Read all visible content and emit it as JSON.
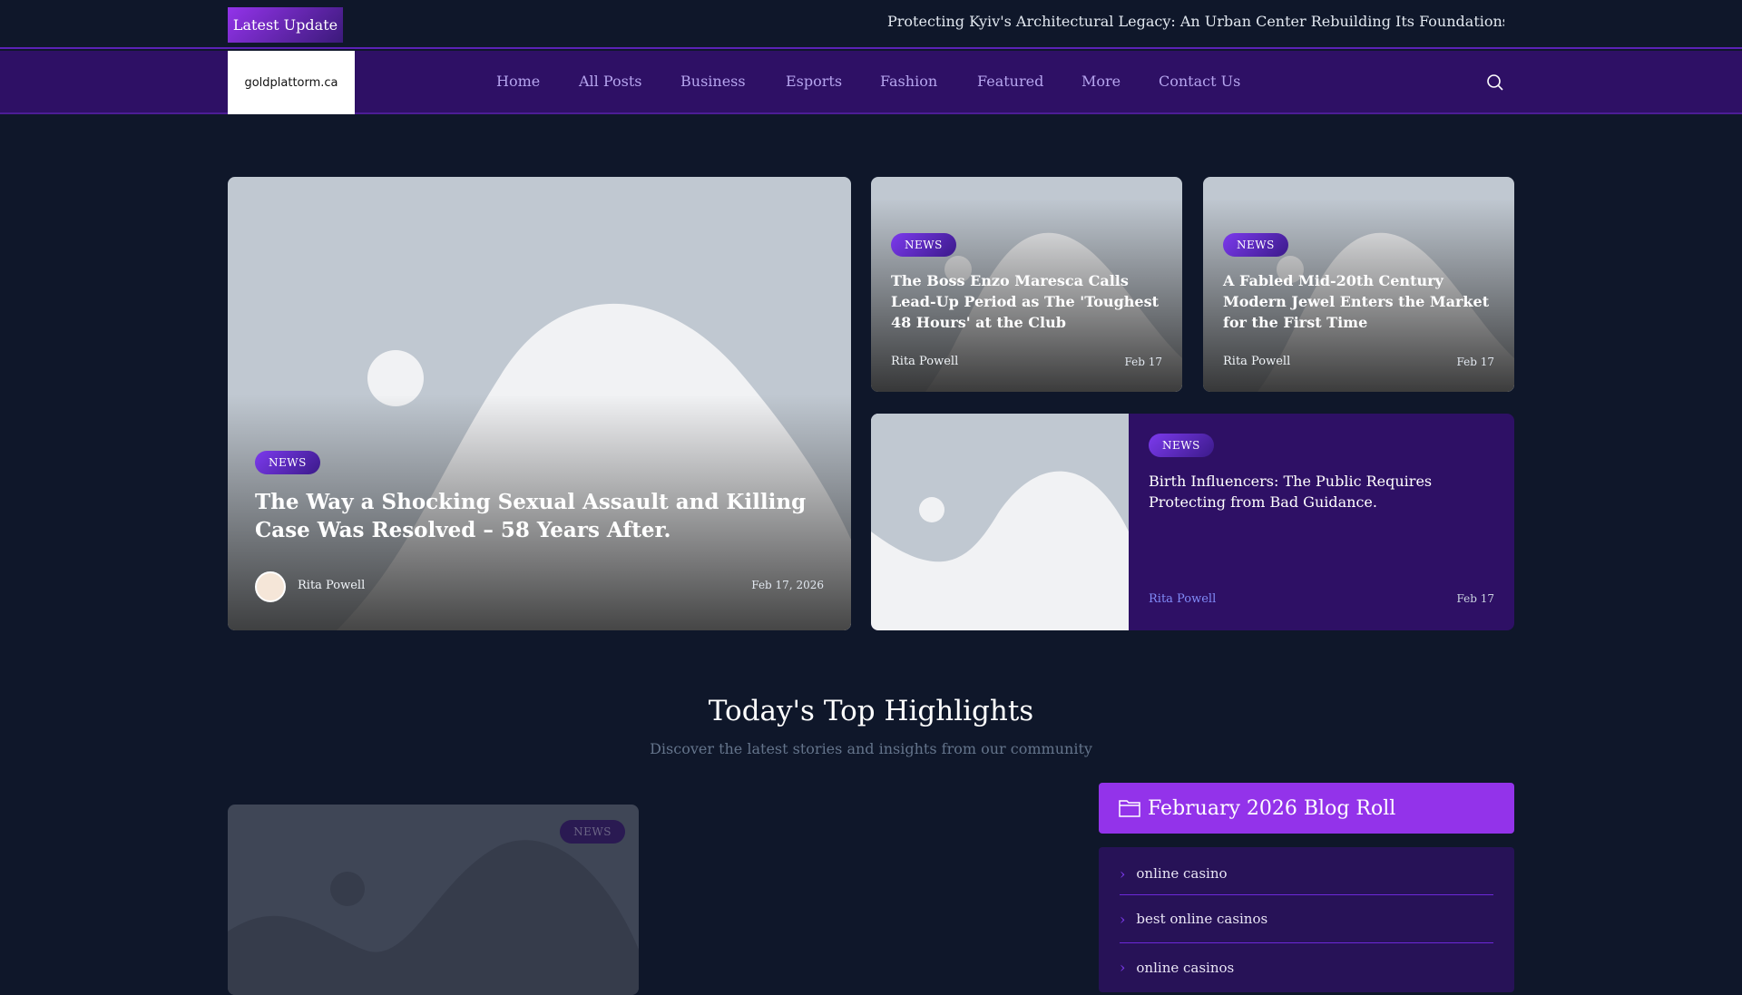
{
  "topbar": {
    "latest_label": "Latest  Update",
    "ticker": "Protecting Kyiv's Architectural Legacy: An Urban Center Rebuilding Its Foundations Under Fire"
  },
  "nav": {
    "logo": "goldplattorm.ca",
    "items": [
      "Home",
      "All Posts",
      "Business",
      "Esports",
      "Fashion",
      "Featured",
      "More",
      "Contact Us"
    ]
  },
  "hero": {
    "badge": "NEWS",
    "title": "The Way a Shocking Sexual Assault and Killing Case Was Resolved – 58 Years After.",
    "author": "Rita Powell",
    "date": "Feb 17, 2026"
  },
  "cards": [
    {
      "badge": "NEWS",
      "title": "The Boss Enzo Maresca Calls Lead-Up Period as The 'Toughest 48 Hours' at the Club",
      "author": "Rita Powell",
      "date": "Feb 17"
    },
    {
      "badge": "NEWS",
      "title": "A Fabled Mid-20th Century Modern Jewel Enters the Market for the First Time",
      "author": "Rita Powell",
      "date": "Feb 17"
    }
  ],
  "wide": {
    "badge": "NEWS",
    "title": "Birth Influencers: The Public Requires Protecting from Bad Guidance.",
    "author": "Rita Powell",
    "date": "Feb 17"
  },
  "highlights": {
    "title": "Today's Top Highlights",
    "subtitle": "Discover the latest stories and insights from our community",
    "card_badge": "NEWS"
  },
  "blogroll": {
    "title": "February 2026 Blog Roll",
    "items": [
      "online casino",
      "best online casinos",
      "online casinos"
    ]
  }
}
